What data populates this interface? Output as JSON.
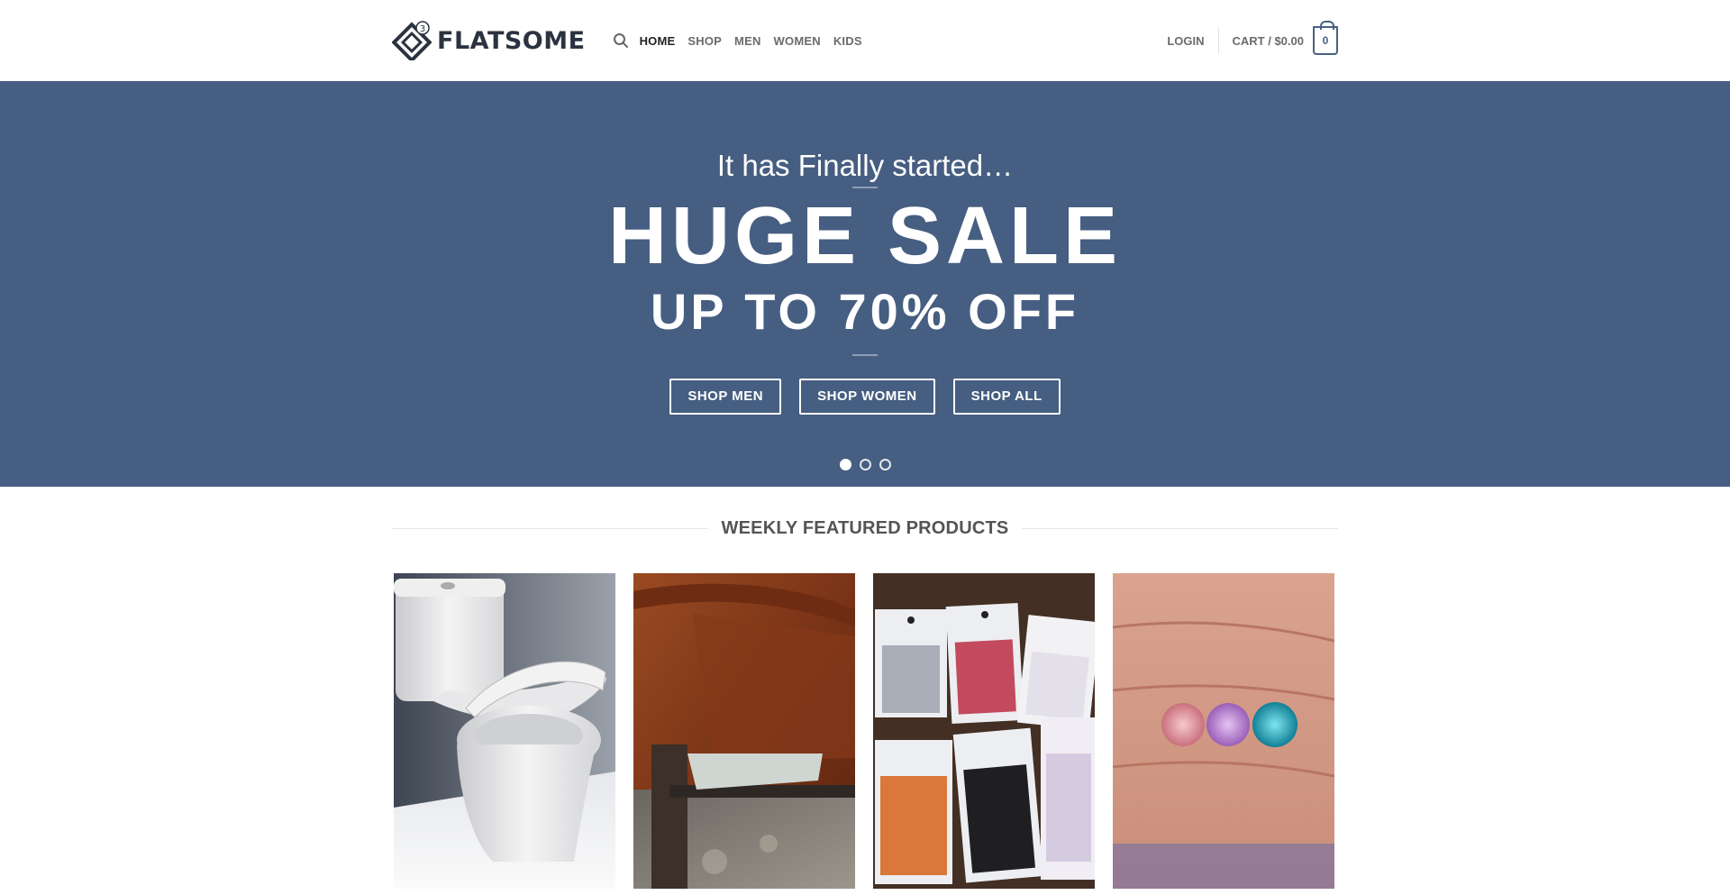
{
  "brand": {
    "name": "FLATSOME",
    "badge": "3"
  },
  "nav": {
    "items": [
      {
        "label": "HOME",
        "active": true
      },
      {
        "label": "SHOP",
        "active": false
      },
      {
        "label": "MEN",
        "active": false
      },
      {
        "label": "WOMEN",
        "active": false
      },
      {
        "label": "KIDS",
        "active": false
      }
    ]
  },
  "account": {
    "login_label": "LOGIN"
  },
  "cart": {
    "label": "CART / $0.00",
    "count": "0"
  },
  "hero": {
    "subtitle": "It has Finally started…",
    "title": "HUGE SALE",
    "title2": "UP TO 70% OFF",
    "buttons": [
      "SHOP MEN",
      "SHOP WOMEN",
      "SHOP ALL"
    ],
    "slides": 3,
    "active_slide": 1,
    "background_color": "#465e81"
  },
  "featured": {
    "title": "WEEKLY FEATURED PRODUCTS",
    "products": [
      {
        "image": "toilet"
      },
      {
        "image": "wooden-furniture"
      },
      {
        "image": "glitter-bags"
      },
      {
        "image": "gemstones-on-hand"
      }
    ]
  }
}
